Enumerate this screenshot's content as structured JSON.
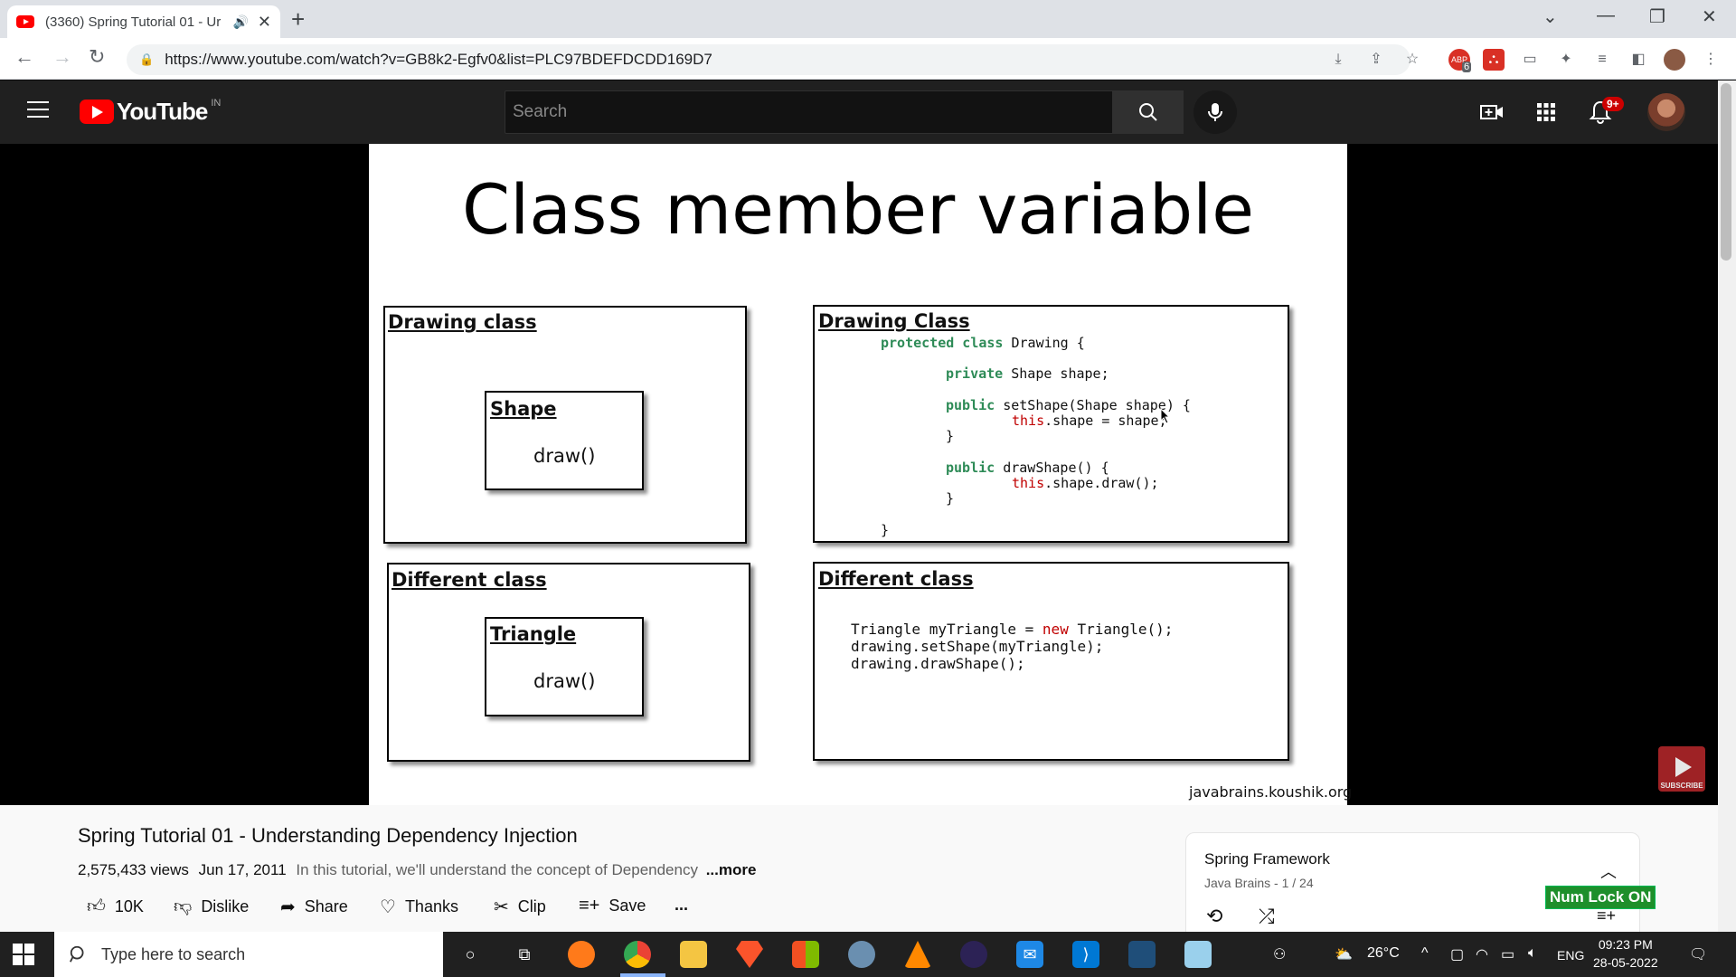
{
  "browser": {
    "tab_title": "(3360) Spring Tutorial 01 - Ur",
    "url": "https://www.youtube.com/watch?v=GB8k2-Egfv0&list=PLC97BDEFDCDD169D7",
    "ext_badge": "6"
  },
  "youtube": {
    "logo_text": "YouTube",
    "country_code": "IN",
    "search_placeholder": "Search",
    "notification_count": "9+"
  },
  "slide": {
    "title": "Class member variable",
    "drawing_class_label": "Drawing class",
    "shape_label": "Shape",
    "draw_label_1": "draw()",
    "different_class_label": "Different class",
    "triangle_label": "Triangle",
    "draw_label_2": "draw()",
    "code1_label": "Drawing Class",
    "code2_label": "Different class",
    "watermark": "javabrains.koushik.org",
    "subscribe_text": "SUBSCRIBE"
  },
  "code1": {
    "l1a": "protected class",
    "l1b": " Drawing {",
    "l2a": "private",
    "l2b": " Shape shape;",
    "l3a": "public",
    "l3b": " setShape(Shape shape) {",
    "l4a": "this",
    "l4b": ".shape = shape;",
    "l5": "}",
    "l6a": "public",
    "l6b": " drawShape() {",
    "l7a": "this",
    "l7b": ".shape.draw();",
    "l8": "}",
    "l9": "}"
  },
  "code2": {
    "l1a": "Triangle myTriangle = ",
    "l1b": "new",
    "l1c": " Triangle();",
    "l2": "drawing.setShape(myTriangle);",
    "l3": "drawing.drawShape();"
  },
  "video": {
    "title": "Spring Tutorial 01 - Understanding Dependency Injection",
    "views": "2,575,433 views",
    "date": "Jun 17, 2011",
    "description": "In this tutorial, we'll understand the concept of Dependency",
    "more": "...more",
    "actions": {
      "like": "10K",
      "dislike": "Dislike",
      "share": "Share",
      "thanks": "Thanks",
      "clip": "Clip",
      "save": "Save",
      "overflow": "..."
    }
  },
  "playlist": {
    "title": "Spring Framework",
    "subtitle": "Java Brains - 1 / 24"
  },
  "overlay": {
    "numlock": "Num Lock ON"
  },
  "taskbar": {
    "search_placeholder": "Type here to search",
    "temperature": "26°C",
    "language": "ENG",
    "time": "09:23 PM",
    "date": "28-05-2022"
  }
}
